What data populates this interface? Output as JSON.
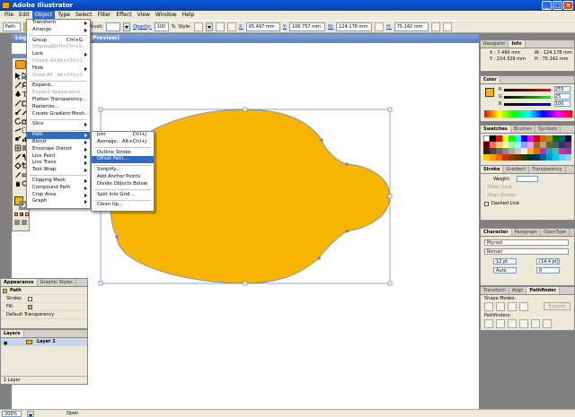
{
  "app": {
    "title": "Adobe Illustrator",
    "window_buttons": [
      "_",
      "□",
      "×"
    ]
  },
  "menubar": [
    "File",
    "Edit",
    "Object",
    "Type",
    "Select",
    "Filter",
    "Effect",
    "View",
    "Window",
    "Help"
  ],
  "control_bar": {
    "selection_label": "Path",
    "brush_label": "Brush:",
    "opacity_label": "Opacity:",
    "opacity_value": "100",
    "opacity_unit": "%",
    "style_label": "Style:",
    "x_label": "X:",
    "x_value": "65.497 mm",
    "y_label": "Y:",
    "y_value": "106.757 mm",
    "w_label": "W:",
    "w_value": "124.178 mm",
    "h_label": "H:",
    "h_value": "75.142 mm"
  },
  "document": {
    "title_left": "Logo",
    "title_right": "/Preview)"
  },
  "object_menu": [
    {
      "label": "Transform",
      "submenu": true
    },
    {
      "label": "Arrange",
      "submenu": true
    },
    {
      "sep": true
    },
    {
      "label": "Group",
      "shortcut": "Ctrl+G"
    },
    {
      "label": "Ungroup",
      "shortcut": "Shift+Ctrl+G",
      "disabled": true
    },
    {
      "label": "Lock",
      "submenu": true
    },
    {
      "label": "Unlock All",
      "shortcut": "Alt+Ctrl+2",
      "disabled": true
    },
    {
      "label": "Hide",
      "submenu": true
    },
    {
      "label": "Show All",
      "shortcut": "Alt+Ctrl+3",
      "disabled": true
    },
    {
      "sep": true
    },
    {
      "label": "Expand..."
    },
    {
      "label": "Expand Appearance",
      "disabled": true
    },
    {
      "label": "Flatten Transparency..."
    },
    {
      "label": "Rasterize..."
    },
    {
      "label": "Create Gradient Mesh..."
    },
    {
      "sep": true
    },
    {
      "label": "Slice",
      "submenu": true
    },
    {
      "sep": true
    },
    {
      "label": "Path",
      "submenu": true,
      "highlight": true
    },
    {
      "label": "Blend",
      "submenu": true
    },
    {
      "label": "Envelope Distort",
      "submenu": true
    },
    {
      "label": "Live Paint",
      "submenu": true
    },
    {
      "label": "Live Trace",
      "submenu": true
    },
    {
      "label": "Text Wrap",
      "submenu": true
    },
    {
      "sep": true
    },
    {
      "label": "Clipping Mask",
      "submenu": true
    },
    {
      "label": "Compound Path",
      "submenu": true
    },
    {
      "label": "Crop Area",
      "submenu": true
    },
    {
      "label": "Graph",
      "submenu": true
    }
  ],
  "path_menu": [
    {
      "label": "Join",
      "shortcut": "Ctrl+J"
    },
    {
      "label": "Average...",
      "shortcut": "Alt+Ctrl+J"
    },
    {
      "sep": true
    },
    {
      "label": "Outline Stroke"
    },
    {
      "label": "Offset Path...",
      "highlight": true
    },
    {
      "sep": true
    },
    {
      "label": "Simplify..."
    },
    {
      "label": "Add Anchor Points"
    },
    {
      "label": "Divide Objects Below"
    },
    {
      "sep": true
    },
    {
      "label": "Split Into Grid..."
    },
    {
      "sep": true
    },
    {
      "label": "Clean Up..."
    }
  ],
  "appearance": {
    "tabs": [
      "Appearance",
      "Graphic Styles"
    ],
    "item": "Path",
    "stroke_label": "Stroke:",
    "fill_label": "Fill:",
    "default_transparency": "Default Transparency"
  },
  "layers": {
    "tab": "Layers",
    "layer_name": "Layer 1",
    "status": "1 Layer"
  },
  "right": {
    "info": {
      "tabs": [
        "Navigator",
        "Info"
      ],
      "x": "X : 7.490 mm",
      "y": "Y : 224.329 mm",
      "w": "W : 124.178 mm",
      "h": "H : 75.142 mm"
    },
    "color": {
      "tab": "Color",
      "r": "R",
      "g": "G",
      "b": "B",
      "r_val": "255",
      "g_val": "25",
      "b_val": "100"
    },
    "swatches": {
      "tabs": [
        "Swatches",
        "Brushes",
        "Symbols"
      ]
    },
    "stroke": {
      "tabs": [
        "Stroke",
        "Gradient",
        "Transparency"
      ],
      "weight_label": "Weight:",
      "miter_label": "Miter Limit:",
      "align_label": "Align Stroke:",
      "dashed": "Dashed Line"
    },
    "character": {
      "tabs": [
        "Character",
        "Paragraph",
        "OpenType"
      ],
      "font": "Myriad",
      "style": "Roman",
      "size": "12 pt",
      "leading": "(14.4 pt)",
      "kerning": "Auto",
      "tracking": "0"
    },
    "pathfinder": {
      "tabs": [
        "Transform",
        "Align",
        "Pathfinder"
      ],
      "shape_modes": "Shape Modes:",
      "expand": "Expand",
      "pathfinders": "Pathfinders:"
    }
  },
  "status_bar": {
    "zoom": "200%",
    "mode": "Open"
  },
  "colors": {
    "fill": "#f7b500",
    "accent": "#316ac5",
    "selection": "#5b7fd6",
    "title_bar": "#0a58d8"
  }
}
